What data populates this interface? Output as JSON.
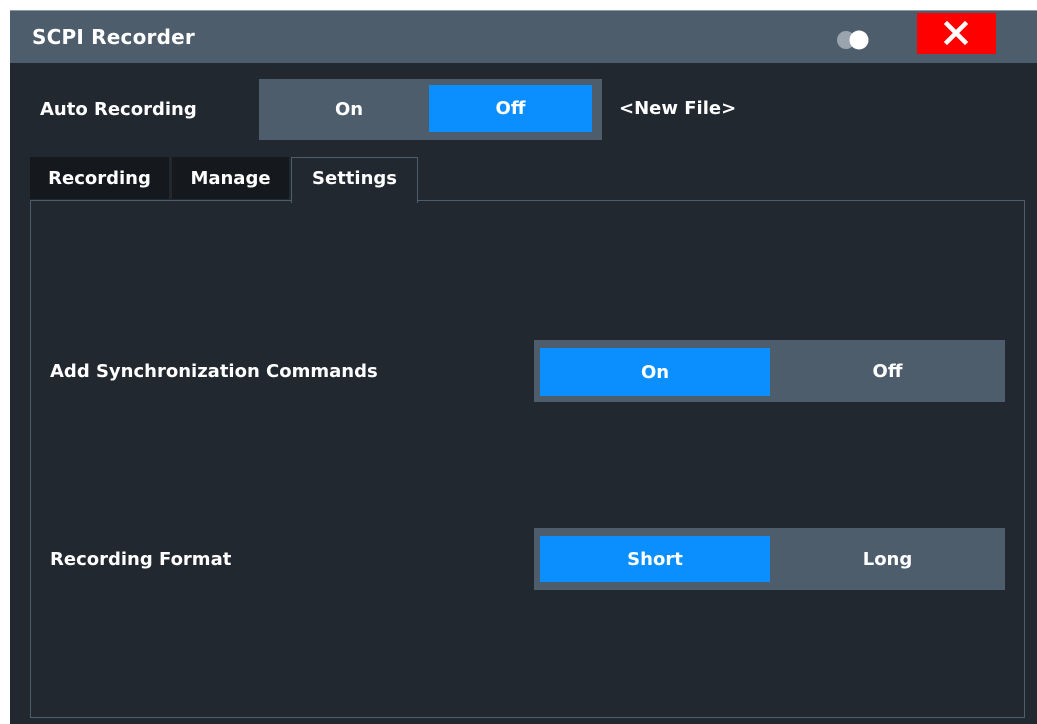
{
  "window": {
    "title": "SCPI Recorder",
    "icons": {
      "toggle": "toggle-icon",
      "close": "close-icon"
    }
  },
  "auto_recording": {
    "label": "Auto Recording",
    "options": [
      "On",
      "Off"
    ],
    "selected": "Off",
    "file": "<New File>"
  },
  "tabs": [
    {
      "label": "Recording",
      "active": false
    },
    {
      "label": "Manage",
      "active": false
    },
    {
      "label": "Settings",
      "active": true
    }
  ],
  "settings": {
    "sync": {
      "label": "Add Synchronization Commands",
      "options": [
        "On",
        "Off"
      ],
      "selected": "On"
    },
    "format": {
      "label": "Recording Format",
      "options": [
        "Short",
        "Long"
      ],
      "selected": "Short"
    }
  },
  "colors": {
    "background": "#222830",
    "bar": "#4d5d6c",
    "accent": "#0b8fff",
    "close": "#ff0000"
  }
}
